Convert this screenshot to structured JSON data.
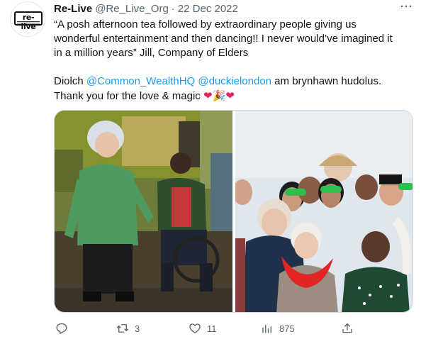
{
  "tweet": {
    "author_name": "Re-Live",
    "handle": "@Re_Live_Org",
    "separator": "·",
    "date": "22 Dec 2022",
    "more_icon": "more-dots-icon",
    "avatar_logo": "re-live",
    "body": {
      "line1": "“A posh afternoon tea followed by extraordinary people giving us",
      "line2": "wonderful entertainment and then dancing!! I never would’ve imagined it",
      "line3": "in a million years” Jill, Company of Elders",
      "line4_prefix": "Diolch ",
      "mention1": "@Common_WealthHQ",
      "mention2": "@duckielondon",
      "line4_suffix": " am brynhawn hudolus.",
      "line5": "Thank you for the love & magic ",
      "emoji_heart": "❤",
      "emoji_party": "🎉"
    },
    "actions": {
      "reply_icon": "reply-icon",
      "retweet_icon": "retweet-icon",
      "retweet_count": "3",
      "like_icon": "heart-icon",
      "like_count": "11",
      "views_icon": "views-icon",
      "views_count": "875",
      "share_icon": "share-icon"
    }
  }
}
